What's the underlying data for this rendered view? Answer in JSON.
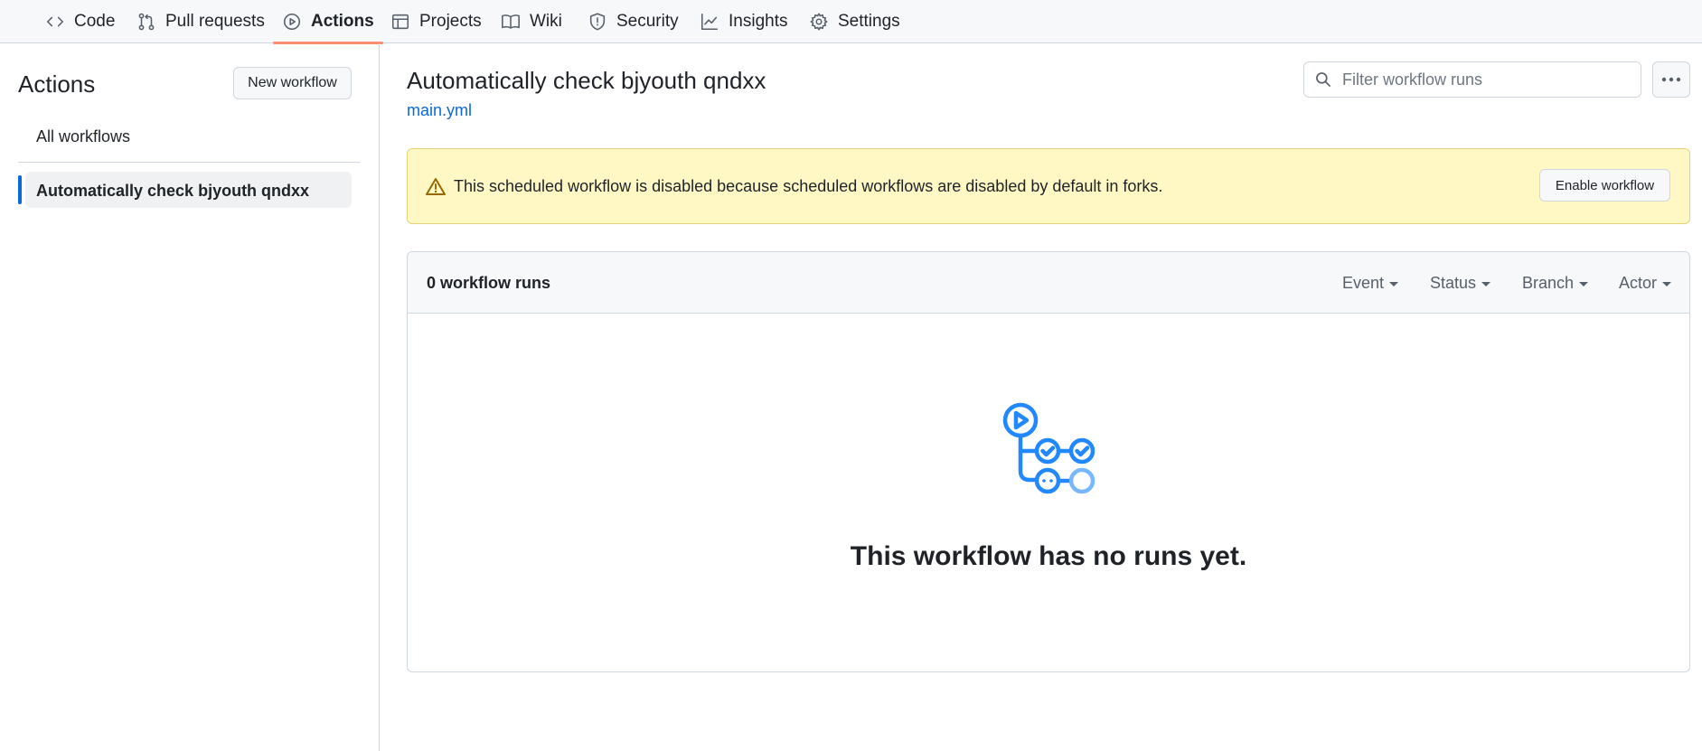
{
  "repo_nav": {
    "tabs": [
      {
        "label": "Code",
        "icon": "code-icon"
      },
      {
        "label": "Pull requests",
        "icon": "git-pull-request-icon"
      },
      {
        "label": "Actions",
        "icon": "play-icon",
        "active": true
      },
      {
        "label": "Projects",
        "icon": "table-icon"
      },
      {
        "label": "Wiki",
        "icon": "book-icon"
      },
      {
        "label": "Security",
        "icon": "shield-icon"
      },
      {
        "label": "Insights",
        "icon": "graph-icon"
      },
      {
        "label": "Settings",
        "icon": "gear-icon"
      }
    ]
  },
  "sidebar": {
    "title": "Actions",
    "new_workflow_label": "New workflow",
    "all_workflows_label": "All workflows",
    "selected_workflow_label": "Automatically check bjyouth qndxx"
  },
  "main": {
    "title": "Automatically check bjyouth qndxx",
    "file": "main.yml",
    "filter_placeholder": "Filter workflow runs",
    "flash": {
      "message": "This scheduled workflow is disabled because scheduled workflows are disabled by default in forks.",
      "enable_label": "Enable workflow",
      "icon": "alert-icon"
    },
    "runs": {
      "count_label": "0 workflow runs",
      "filters": [
        "Event",
        "Status",
        "Branch",
        "Actor"
      ],
      "empty_message": "This workflow has no runs yet.",
      "empty_icon": "workflow-illustration-icon"
    }
  },
  "colors": {
    "accent": "#0969da",
    "active_tab_underline": "#fd8c73",
    "flash_bg": "#fff8c5",
    "illustration_blue": "#2188ff"
  }
}
